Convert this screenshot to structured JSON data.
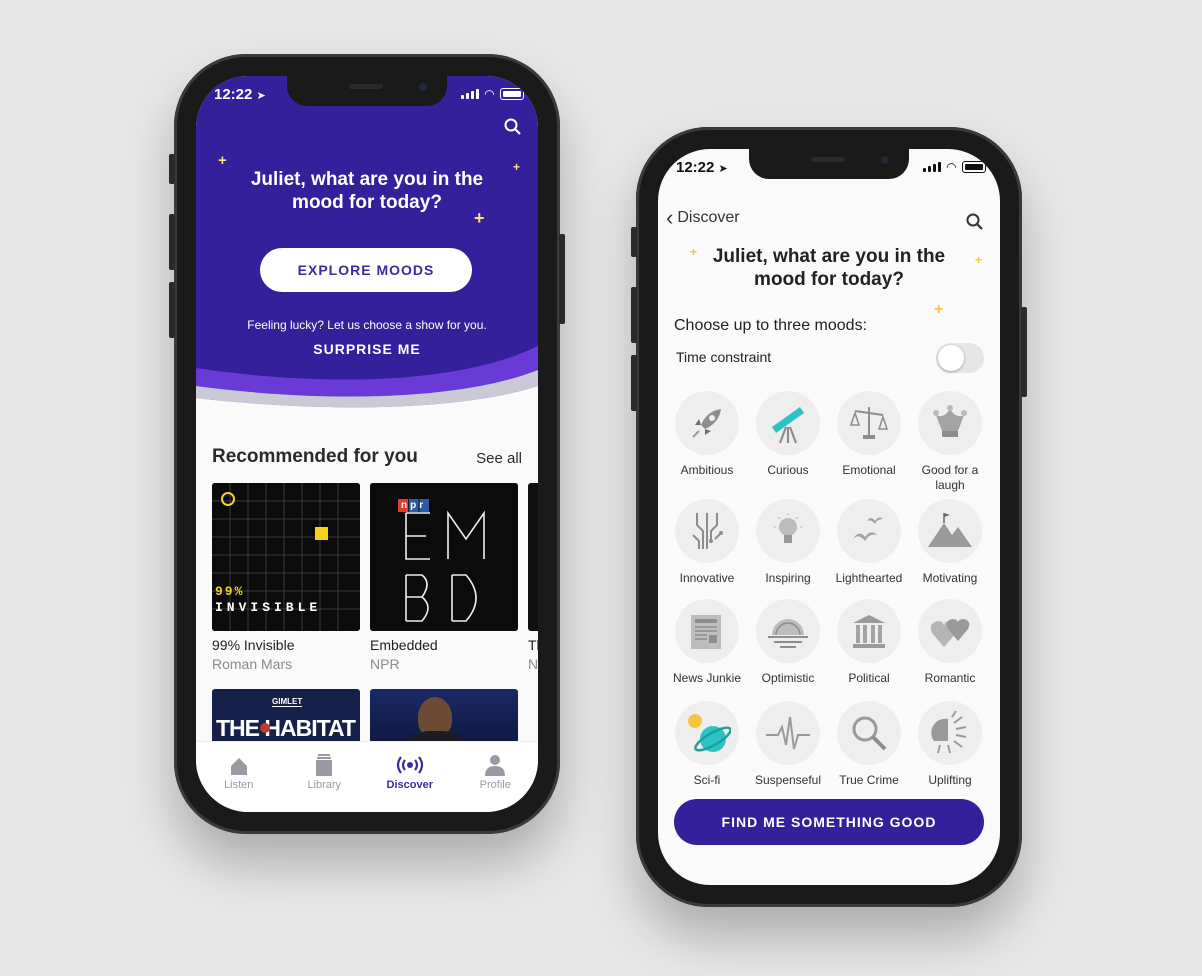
{
  "colors": {
    "brand_purple": "#33209a",
    "accent_purple": "#6a3ad6",
    "sparkle": "#ffe17a",
    "tab_inactive": "#9a9aa5"
  },
  "left_phone": {
    "status_time": "12:22",
    "hero": {
      "title": "Juliet, what are you in the mood for today?",
      "explore_label": "EXPLORE MOODS",
      "lucky_text": "Feeling lucky? Let us choose a show for you.",
      "surprise_label": "SURPRISE ME"
    },
    "recommended": {
      "heading": "Recommended for you",
      "see_all": "See all",
      "items": [
        {
          "title": "99% Invisible",
          "author": "Roman Mars",
          "art_text": "99%",
          "art_text2": "INVISIBLE"
        },
        {
          "title": "Embedded",
          "author": "NPR",
          "art_badge": "npr"
        },
        {
          "title": "Tl",
          "author": "N"
        }
      ],
      "row2": [
        {
          "art_label": "GIMLET",
          "art_text": "THE HABITAT"
        }
      ]
    },
    "tabs": [
      {
        "label": "Listen",
        "icon": "home-icon"
      },
      {
        "label": "Library",
        "icon": "library-icon"
      },
      {
        "label": "Discover",
        "icon": "broadcast-icon",
        "active": true
      },
      {
        "label": "Profile",
        "icon": "person-icon"
      }
    ]
  },
  "right_phone": {
    "status_time": "12:22",
    "nav": {
      "back_label": "Discover"
    },
    "title": "Juliet, what are you in the mood for today?",
    "choose_label": "Choose up to three moods:",
    "time_constraint_label": "Time constraint",
    "time_constraint_on": false,
    "moods": [
      {
        "label": "Ambitious",
        "icon": "rocket-icon"
      },
      {
        "label": "Curious",
        "icon": "telescope-icon"
      },
      {
        "label": "Emotional",
        "icon": "scale-icon"
      },
      {
        "label": "Good for a laugh",
        "icon": "jester-hat-icon"
      },
      {
        "label": "Innovative",
        "icon": "circuit-icon"
      },
      {
        "label": "Inspiring",
        "icon": "lightbulb-icon"
      },
      {
        "label": "Lighthearted",
        "icon": "birds-icon"
      },
      {
        "label": "Motivating",
        "icon": "mountain-flag-icon"
      },
      {
        "label": "News Junkie",
        "icon": "newspaper-icon"
      },
      {
        "label": "Optimistic",
        "icon": "sunrise-icon"
      },
      {
        "label": "Political",
        "icon": "government-building-icon"
      },
      {
        "label": "Romantic",
        "icon": "hearts-icon"
      },
      {
        "label": "Sci-fi",
        "icon": "planet-icon"
      },
      {
        "label": "Suspenseful",
        "icon": "heartbeat-icon"
      },
      {
        "label": "True Crime",
        "icon": "magnifier-icon"
      },
      {
        "label": "Uplifting",
        "icon": "sun-icon"
      }
    ],
    "find_label": "FIND ME SOMETHING GOOD"
  }
}
